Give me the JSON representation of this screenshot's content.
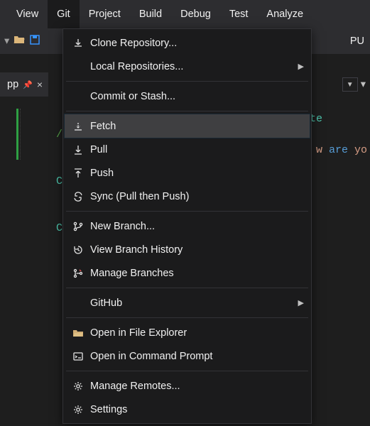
{
  "menubar": {
    "items": [
      "View",
      "Git",
      "Project",
      "Build",
      "Debug",
      "Test",
      "Analyze"
    ],
    "active_index": 1
  },
  "toolbar": {
    "right_text": "PU"
  },
  "tab": {
    "label": "pp"
  },
  "git_menu": {
    "groups": [
      [
        {
          "label": "Clone Repository...",
          "icon": "download-icon"
        },
        {
          "label": "Local Repositories...",
          "icon": "",
          "submenu": true
        }
      ],
      [
        {
          "label": "Commit or Stash...",
          "icon": ""
        }
      ],
      [
        {
          "label": "Fetch",
          "icon": "fetch-icon",
          "hover": true
        },
        {
          "label": "Pull",
          "icon": "pull-icon"
        },
        {
          "label": "Push",
          "icon": "push-icon"
        },
        {
          "label": "Sync (Pull then Push)",
          "icon": "sync-icon"
        }
      ],
      [
        {
          "label": "New Branch...",
          "icon": "branch-icon"
        },
        {
          "label": "View Branch History",
          "icon": "history-icon"
        },
        {
          "label": "Manage Branches",
          "icon": "branches-manage-icon"
        }
      ],
      [
        {
          "label": "GitHub",
          "icon": "",
          "submenu": true
        }
      ],
      [
        {
          "label": "Open in File Explorer",
          "icon": "folder-open-icon"
        },
        {
          "label": "Open in Command Prompt",
          "icon": "terminal-icon"
        }
      ],
      [
        {
          "label": "Manage Remotes...",
          "icon": "gear-icon"
        },
        {
          "label": "Settings",
          "icon": "gear-icon"
        }
      ]
    ]
  },
  "editor": {
    "lines": [
      {
        "t": "comment",
        "text": "// S"
      },
      {
        "t": "call",
        "type": "Cons",
        "rest1": "emplate"
      },
      {
        "t": "call",
        "type": "Cons",
        "rest2a": "w ",
        "rest2b": "are",
        "rest2c": " yo"
      }
    ]
  }
}
